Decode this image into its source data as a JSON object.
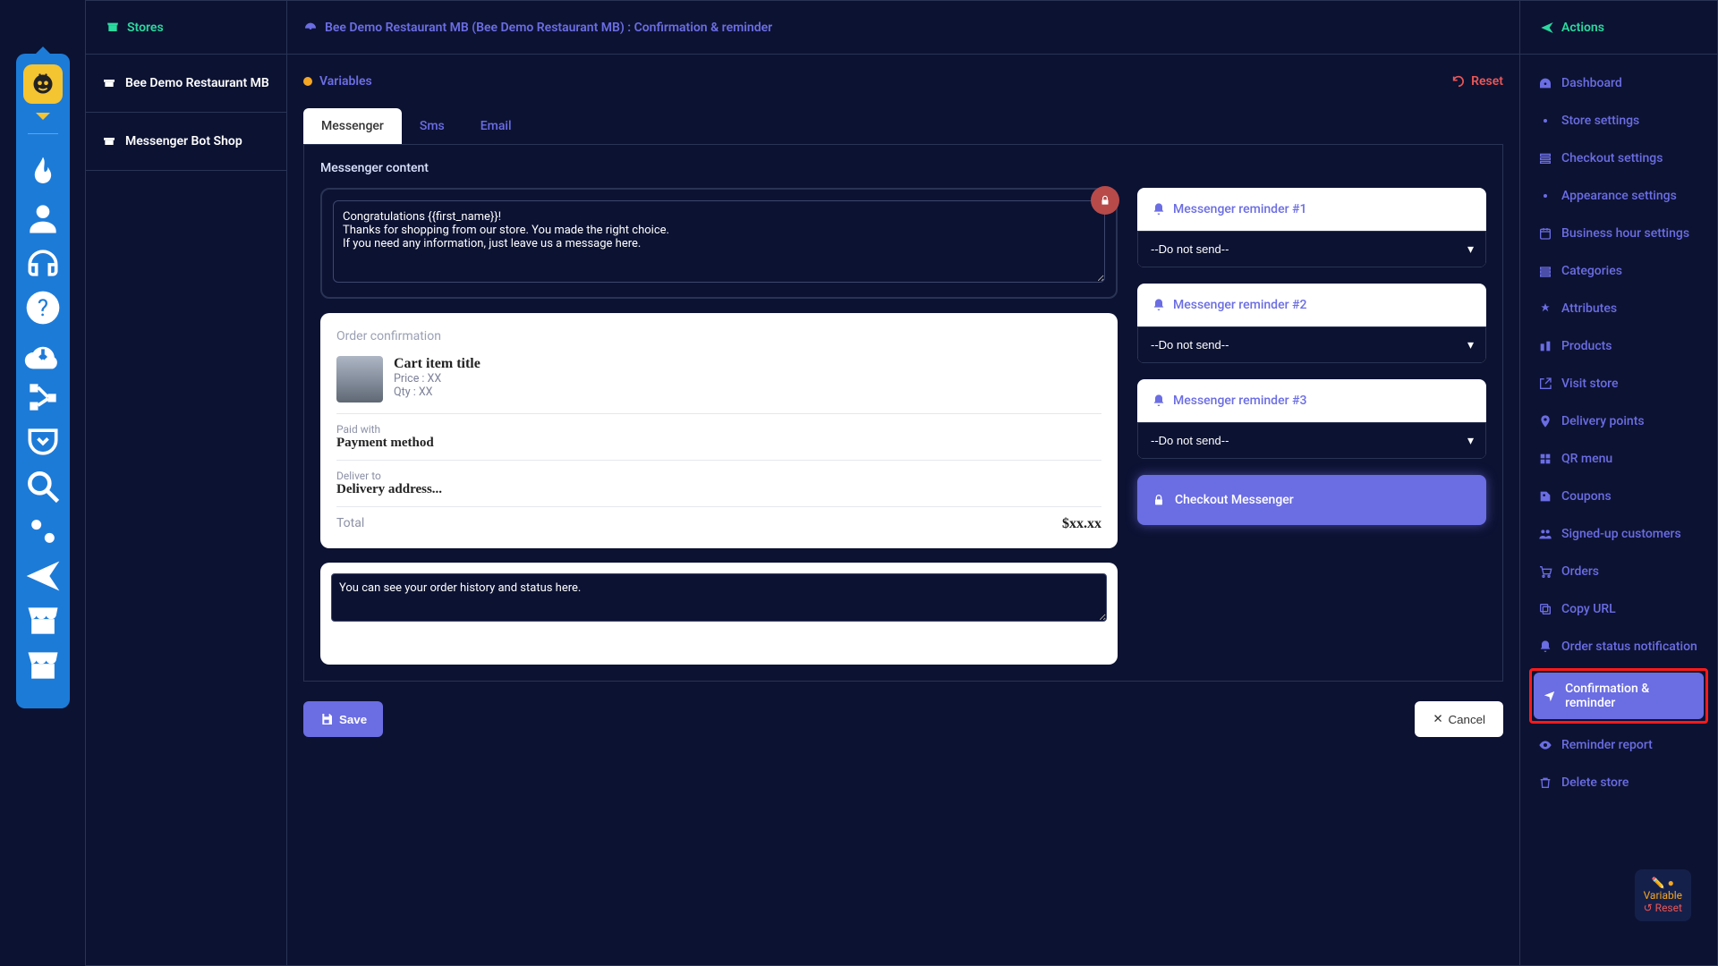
{
  "sidebar": {
    "stores_header": "Stores",
    "items": [
      {
        "label": "Bee Demo Restaurant MB"
      },
      {
        "label": "Messenger Bot Shop"
      }
    ]
  },
  "header": {
    "breadcrumb": "Bee Demo Restaurant MB (Bee Demo Restaurant MB) : Confirmation & reminder"
  },
  "variables_label": "Variables",
  "reset_label": "Reset",
  "tabs": {
    "messenger": "Messenger",
    "sms": "Sms",
    "email": "Email"
  },
  "messenger": {
    "content_label": "Messenger content",
    "intro_text": "Congratulations {{first_name}}!\nThanks for shopping from our store. You made the right choice.\nIf you need any information, just leave us a message here.",
    "order_card": {
      "title": "Order confirmation",
      "item_title": "Cart item title",
      "price_label": "Price : XX",
      "qty_label": "Qty : XX",
      "paid_label": "Paid with",
      "paid_value": "Payment method",
      "deliver_label": "Deliver to",
      "deliver_value": "Delivery address...",
      "total_label": "Total",
      "total_value": "$xx.xx"
    },
    "footer_text": "You can see your order history and status here."
  },
  "reminders": {
    "r1": "Messenger reminder #1",
    "r2": "Messenger reminder #2",
    "r3": "Messenger reminder #3",
    "select_value": "--Do not send--",
    "checkout_label": "Checkout Messenger"
  },
  "buttons": {
    "save": "Save",
    "cancel": "Cancel"
  },
  "actions": {
    "header": "Actions",
    "items": [
      "Dashboard",
      "Store settings",
      "Checkout settings",
      "Appearance settings",
      "Business hour settings",
      "Categories",
      "Attributes",
      "Products",
      "Visit store",
      "Delivery points",
      "QR menu",
      "Coupons",
      "Signed-up customers",
      "Orders",
      "Copy URL",
      "Order status notification",
      "Confirmation & reminder",
      "Reminder report",
      "Delete store"
    ],
    "active_index": 16
  },
  "float": {
    "var": "Variable",
    "reset": "Reset"
  }
}
